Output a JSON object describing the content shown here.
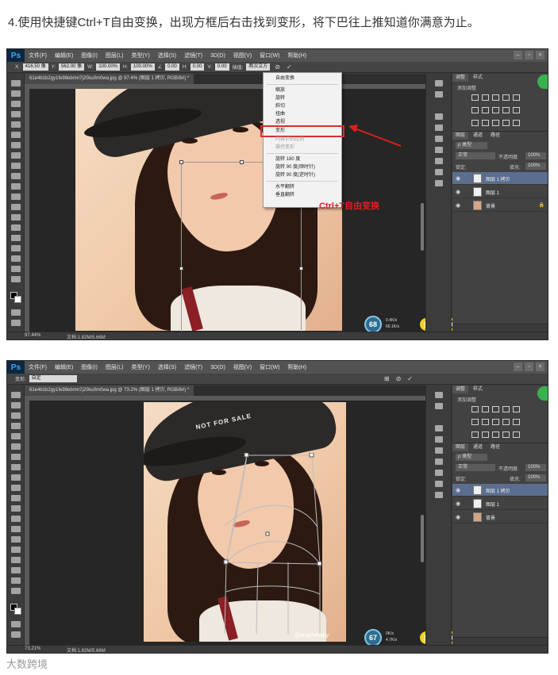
{
  "caption": "4.使用快捷键Ctrl+T自由变换，出现方框后右击找到变形，将下巴往上推知道你满意为止。",
  "app": {
    "logo": "Ps"
  },
  "menu": [
    "文件(F)",
    "编辑(E)",
    "图像(I)",
    "图层(L)",
    "类型(Y)",
    "选择(S)",
    "滤镜(T)",
    "3D(D)",
    "视图(V)",
    "窗口(W)",
    "帮助(H)"
  ],
  "screenshot1": {
    "options": {
      "x_label": "X:",
      "x_value": "416.50 像",
      "y_label": "Y:",
      "y_value": "562.00 像",
      "w_label": "W:",
      "w_value": "100.00%",
      "h_label": "H:",
      "h_value": "100.00%",
      "angle_value": "0.00",
      "h2_label": "H:",
      "h2_value": "0.00",
      "v_label": "V:",
      "v_value": "0.00",
      "interp_label": "插值:",
      "interp_value": "两次立方"
    },
    "doc_tab": "61e4b1b2gy1fe98ebmn7j20ku0m0wa.jpg @ 97.4% (图层 1 拷贝, RGB/8#) *",
    "status": {
      "zoom": "97.44%",
      "doc": "文档:1.82M/5.66M"
    },
    "context_menu": {
      "items": [
        {
          "label": "自由变换",
          "disabled": false
        },
        {
          "label": "缩放",
          "disabled": false
        },
        {
          "label": "旋转",
          "disabled": false
        },
        {
          "label": "斜切",
          "disabled": false
        },
        {
          "label": "扭曲",
          "disabled": false
        },
        {
          "label": "透视",
          "disabled": false
        },
        {
          "label": "变形",
          "disabled": false
        },
        {
          "label": "内容识别比例",
          "disabled": true
        },
        {
          "label": "操控变形",
          "disabled": true
        },
        {
          "label": "旋转 180 度",
          "disabled": false
        },
        {
          "label": "旋转 90 度(顺时针)",
          "disabled": false
        },
        {
          "label": "旋转 90 度(逆时针)",
          "disabled": false
        },
        {
          "label": "水平翻转",
          "disabled": false
        },
        {
          "label": "垂直翻转",
          "disabled": false
        }
      ]
    },
    "annotation": "Ctrl+T自由变换",
    "speed": "68",
    "net_up": "0.4K/s",
    "net_down": "66.1K/s",
    "pill": "简"
  },
  "screenshot2": {
    "options": {
      "mode_label": "变形:",
      "mode_value": "自定"
    },
    "doc_tab": "61e4b1b2gy1fe98ebmn7j20ku0m0wa.jpg @ 73.2% (图层 1 拷贝, RGB/8#) *",
    "status": {
      "zoom": "73.21%",
      "doc": "文档:1.82M/5.66M"
    },
    "cap_text": "NOT FOR SALE",
    "watermark": "@angelababy",
    "speed": "67",
    "net_up": "0K/s",
    "net_down": "4.7K/s",
    "pill": "简"
  },
  "panel": {
    "tabs": [
      "调整",
      "样式"
    ],
    "adjust_title": "添加调整",
    "layers_tabs": [
      "图层",
      "通道",
      "路径"
    ],
    "kind": "ρ 类型",
    "blend": "正常",
    "opacity_label": "不透明度:",
    "opacity_value": "100%",
    "lock_label": "锁定:",
    "fill_label": "填充:",
    "fill_value": "100%",
    "layers": [
      {
        "name": "图层 1 拷贝",
        "selected": true,
        "thumb": "mask"
      },
      {
        "name": "图层 1",
        "selected": false,
        "thumb": "mask"
      },
      {
        "name": "背景",
        "selected": false,
        "thumb": "photo",
        "locked": true
      }
    ]
  },
  "footer_logo": "大数跨境",
  "colors": {
    "ps_bg": "#3a3a3a",
    "highlight": "#e02b2b",
    "accent_badge": "#37b24d",
    "pill": "#f7d11d"
  }
}
